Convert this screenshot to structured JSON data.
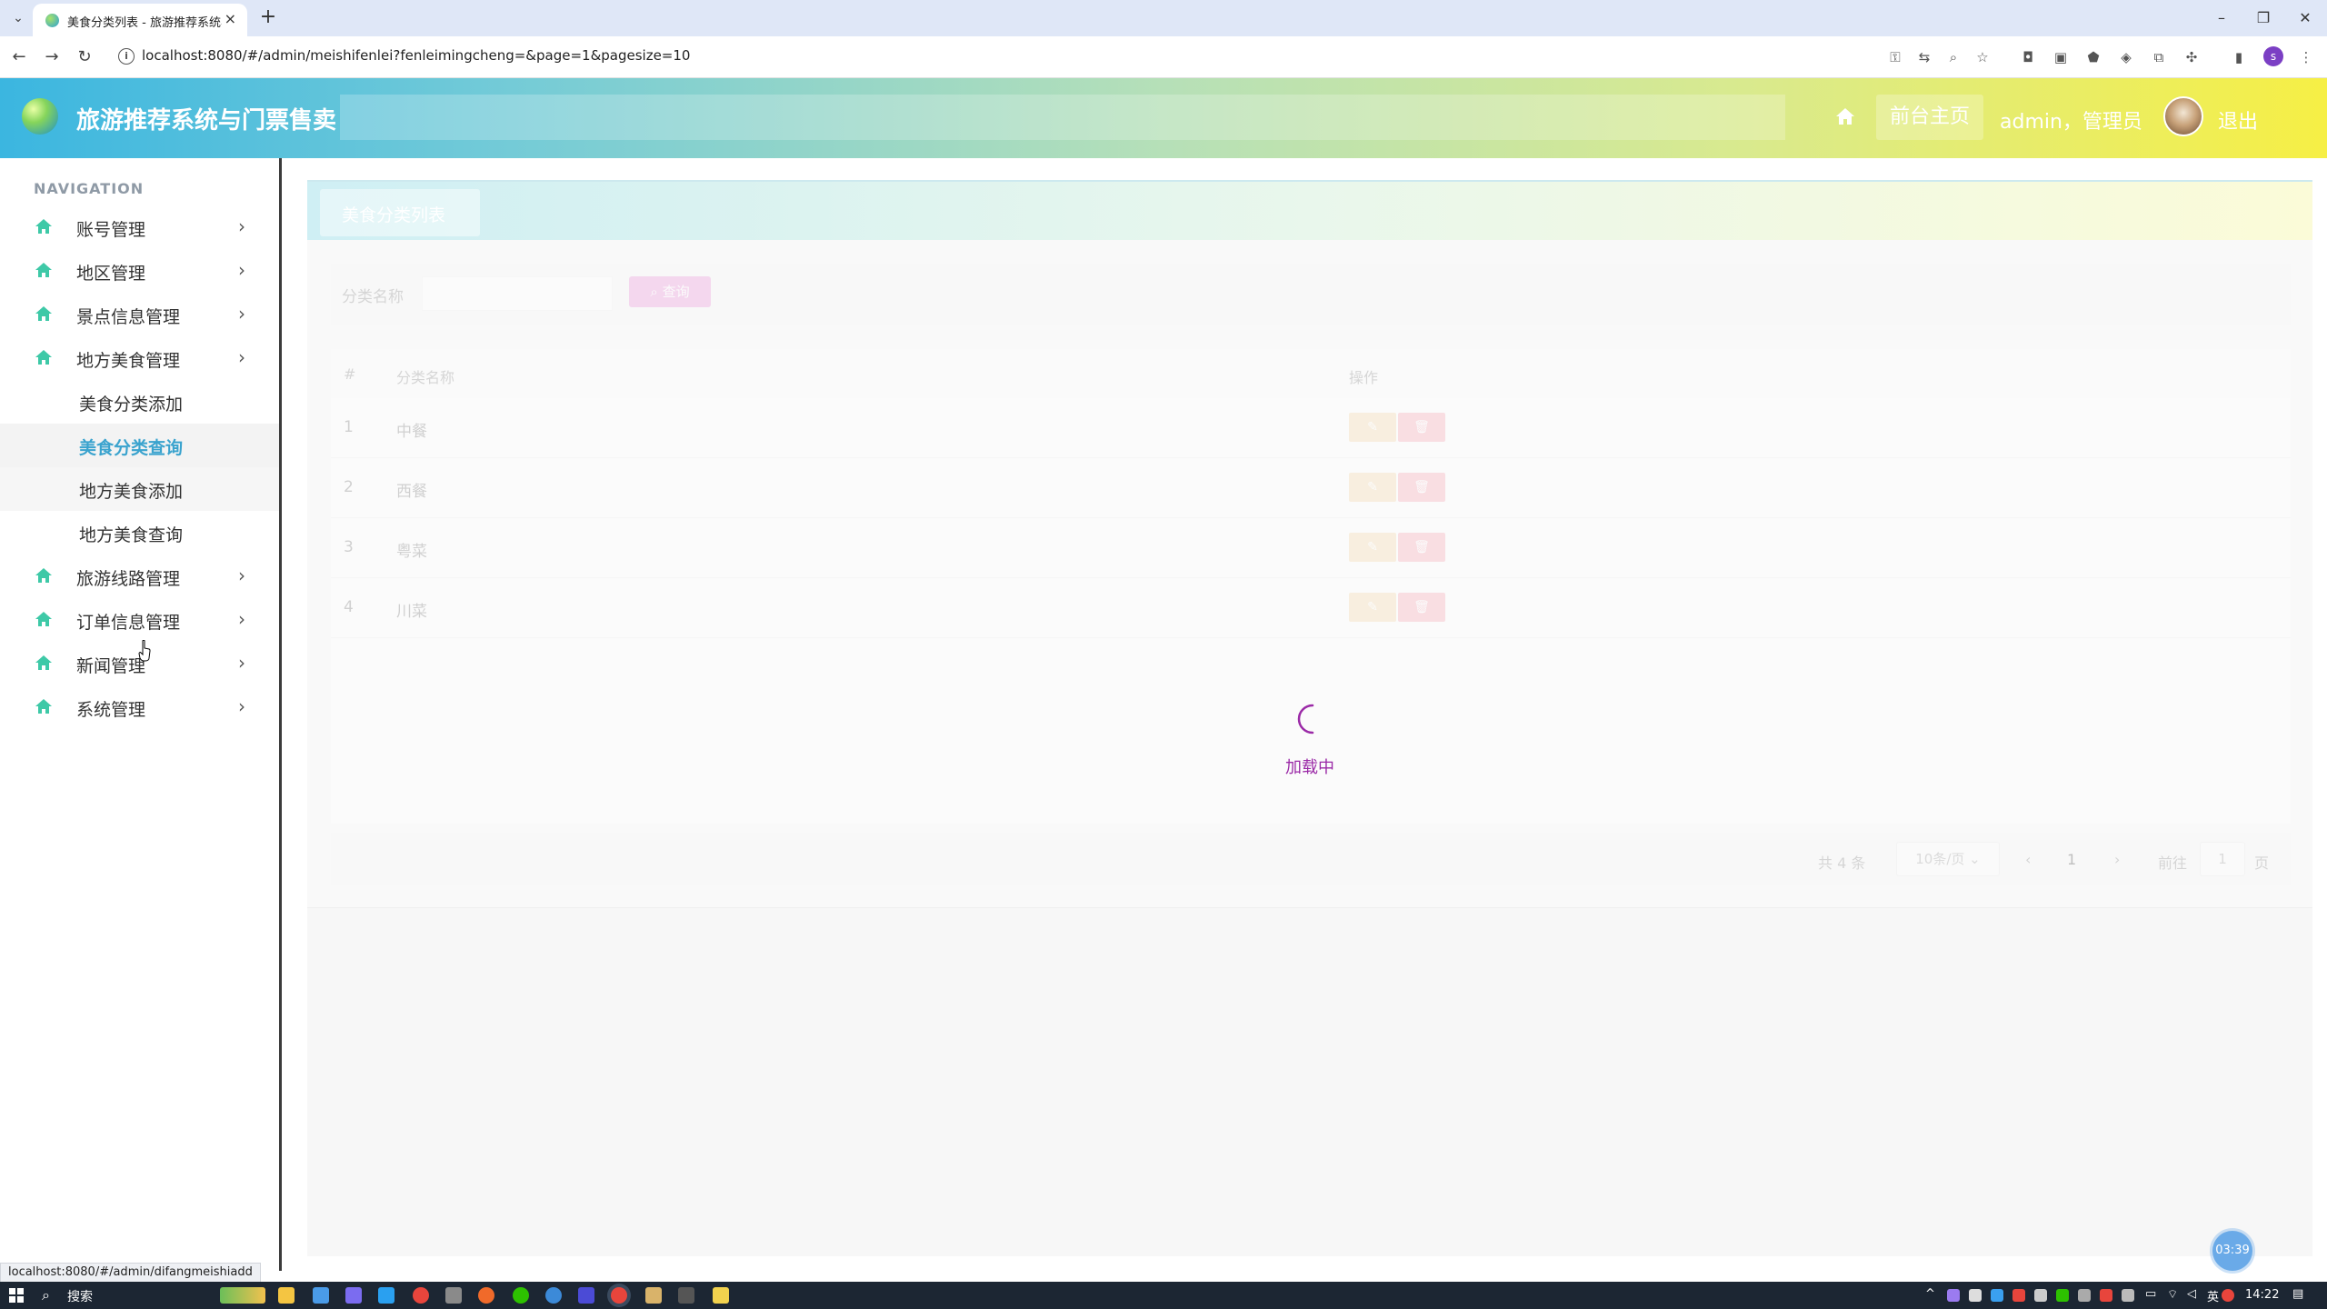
{
  "browser": {
    "tab_title": "美食分类列表 - 旅游推荐系统与",
    "url": "localhost:8080/#/admin/meishifenlei?fenleimingcheng=&page=1&pagesize=10",
    "status_url": "localhost:8080/#/admin/difangmeishiadd"
  },
  "header": {
    "title": "旅游推荐系统与门票售卖",
    "front_link": "前台主页",
    "user": "admin，管理员",
    "logout": "退出"
  },
  "sidebar": {
    "heading": "NAVIGATION",
    "items": [
      {
        "label": "账号管理"
      },
      {
        "label": "地区管理"
      },
      {
        "label": "景点信息管理"
      },
      {
        "label": "地方美食管理"
      },
      {
        "label": "旅游线路管理"
      },
      {
        "label": "订单信息管理"
      },
      {
        "label": "新闻管理"
      },
      {
        "label": "系统管理"
      }
    ],
    "subitems": [
      {
        "label": "美食分类添加"
      },
      {
        "label": "美食分类查询"
      },
      {
        "label": "地方美食添加"
      },
      {
        "label": "地方美食查询"
      }
    ]
  },
  "page": {
    "title": "美食分类列表",
    "search_label": "分类名称",
    "search_value": "",
    "search_button": "查询",
    "columns": [
      "#",
      "分类名称",
      "操作"
    ],
    "rows": [
      {
        "index": "1",
        "name": "中餐"
      },
      {
        "index": "2",
        "name": "西餐"
      },
      {
        "index": "3",
        "name": "粤菜"
      },
      {
        "index": "4",
        "name": "川菜"
      }
    ],
    "pager": {
      "total": "共 4 条",
      "page_size": "10条/页",
      "current": "1",
      "goto_label": "前往",
      "goto_value": "1",
      "page_unit": "页"
    },
    "loading": "加载中"
  },
  "timer": "03:39",
  "taskbar": {
    "search": "搜索",
    "lang": "英",
    "time": "14:22"
  },
  "colors": {
    "accent": "#3aa3ce",
    "loading": "#9b2aa7",
    "search_button": "#e98ed7"
  }
}
